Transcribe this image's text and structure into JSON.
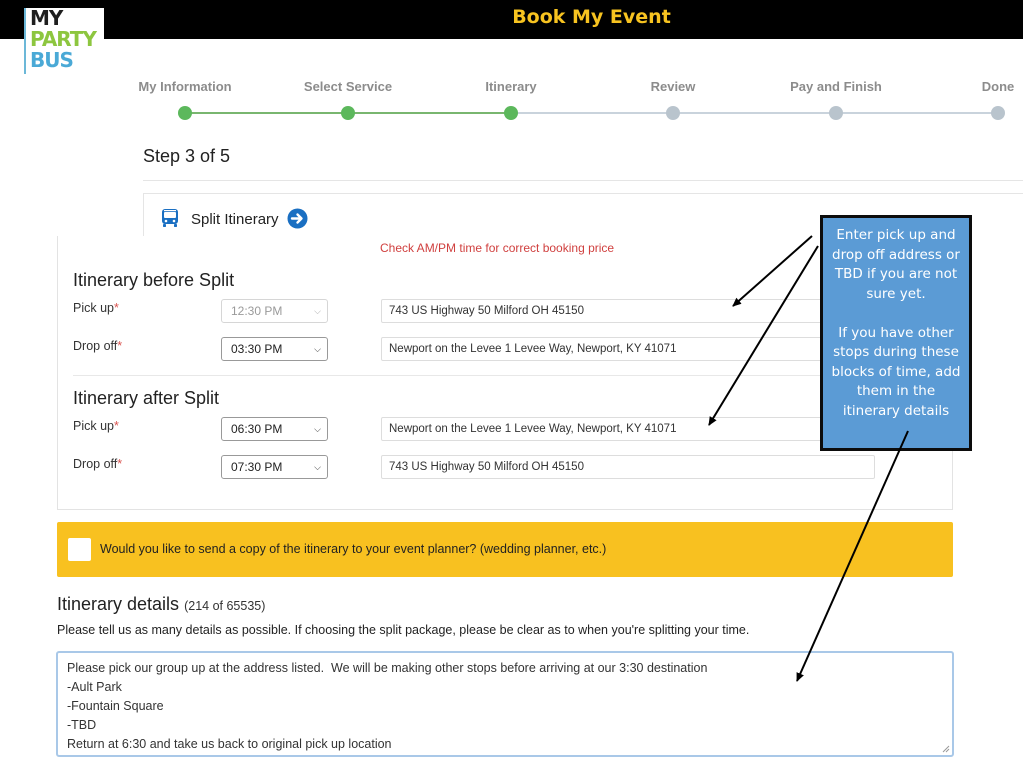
{
  "header": {
    "title": "Book My Event"
  },
  "logo": {
    "line1": "MY",
    "line2": "PARTY",
    "line3": "BUS"
  },
  "progress": {
    "steps": [
      {
        "label": "My Information",
        "status": "done"
      },
      {
        "label": "Select Service",
        "status": "done"
      },
      {
        "label": "Itinerary",
        "status": "current"
      },
      {
        "label": "Review",
        "status": "todo"
      },
      {
        "label": "Pay and Finish",
        "status": "todo"
      },
      {
        "label": "Done",
        "status": "todo"
      }
    ],
    "step_text": "Step 3 of 5"
  },
  "service": {
    "name": "Split Itinerary",
    "icon": "bus-icon",
    "action_icon": "arrow-right-circle-icon"
  },
  "warning": "Check AM/PM time for correct booking price",
  "before_split": {
    "title": "Itinerary before Split",
    "pickup": {
      "label": "Pick up",
      "time": "12:30 PM",
      "address": "743 US Highway 50 Milford OH 45150"
    },
    "dropoff": {
      "label": "Drop off",
      "time": "03:30 PM",
      "address": "Newport on the Levee  1 Levee Way, Newport, KY 41071"
    }
  },
  "after_split": {
    "title": "Itinerary after Split",
    "pickup": {
      "label": "Pick up",
      "time": "06:30 PM",
      "address": "Newport on the Levee  1 Levee Way, Newport, KY 41071"
    },
    "dropoff": {
      "label": "Drop off",
      "time": "07:30 PM",
      "address": "743 US Highway 50 Milford OH 45150"
    }
  },
  "required_mark": "*",
  "planner_copy": {
    "label": "Would you like to send a copy of the itinerary to your event planner? (wedding planner, etc.)",
    "checked": false
  },
  "details": {
    "title": "Itinerary details",
    "count": "(214 of 65535)",
    "help": "Please tell us as many details as possible. If choosing the split package, please be clear as to when you're splitting your time.",
    "lines": [
      "Please pick our group up at the address listed.  We will be making other stops before arriving at our 3:30 destination",
      "-Ault Park",
      "-Fountain Square",
      "-TBD",
      "Return at 6:30 and take us back to original pick up location"
    ]
  },
  "callout": {
    "para1": "Enter pick up  and drop off address or TBD if you are not sure yet.",
    "para2": "If you have other stops during these blocks of time, add them in the itinerary details"
  },
  "colors": {
    "header_bg": "#000000",
    "header_text": "#f7c320",
    "step_done": "#5cb85c",
    "step_todo": "#b9c4cd",
    "banner": "#f8c120",
    "callout": "#5b9bd5",
    "warning": "#d0403f"
  }
}
